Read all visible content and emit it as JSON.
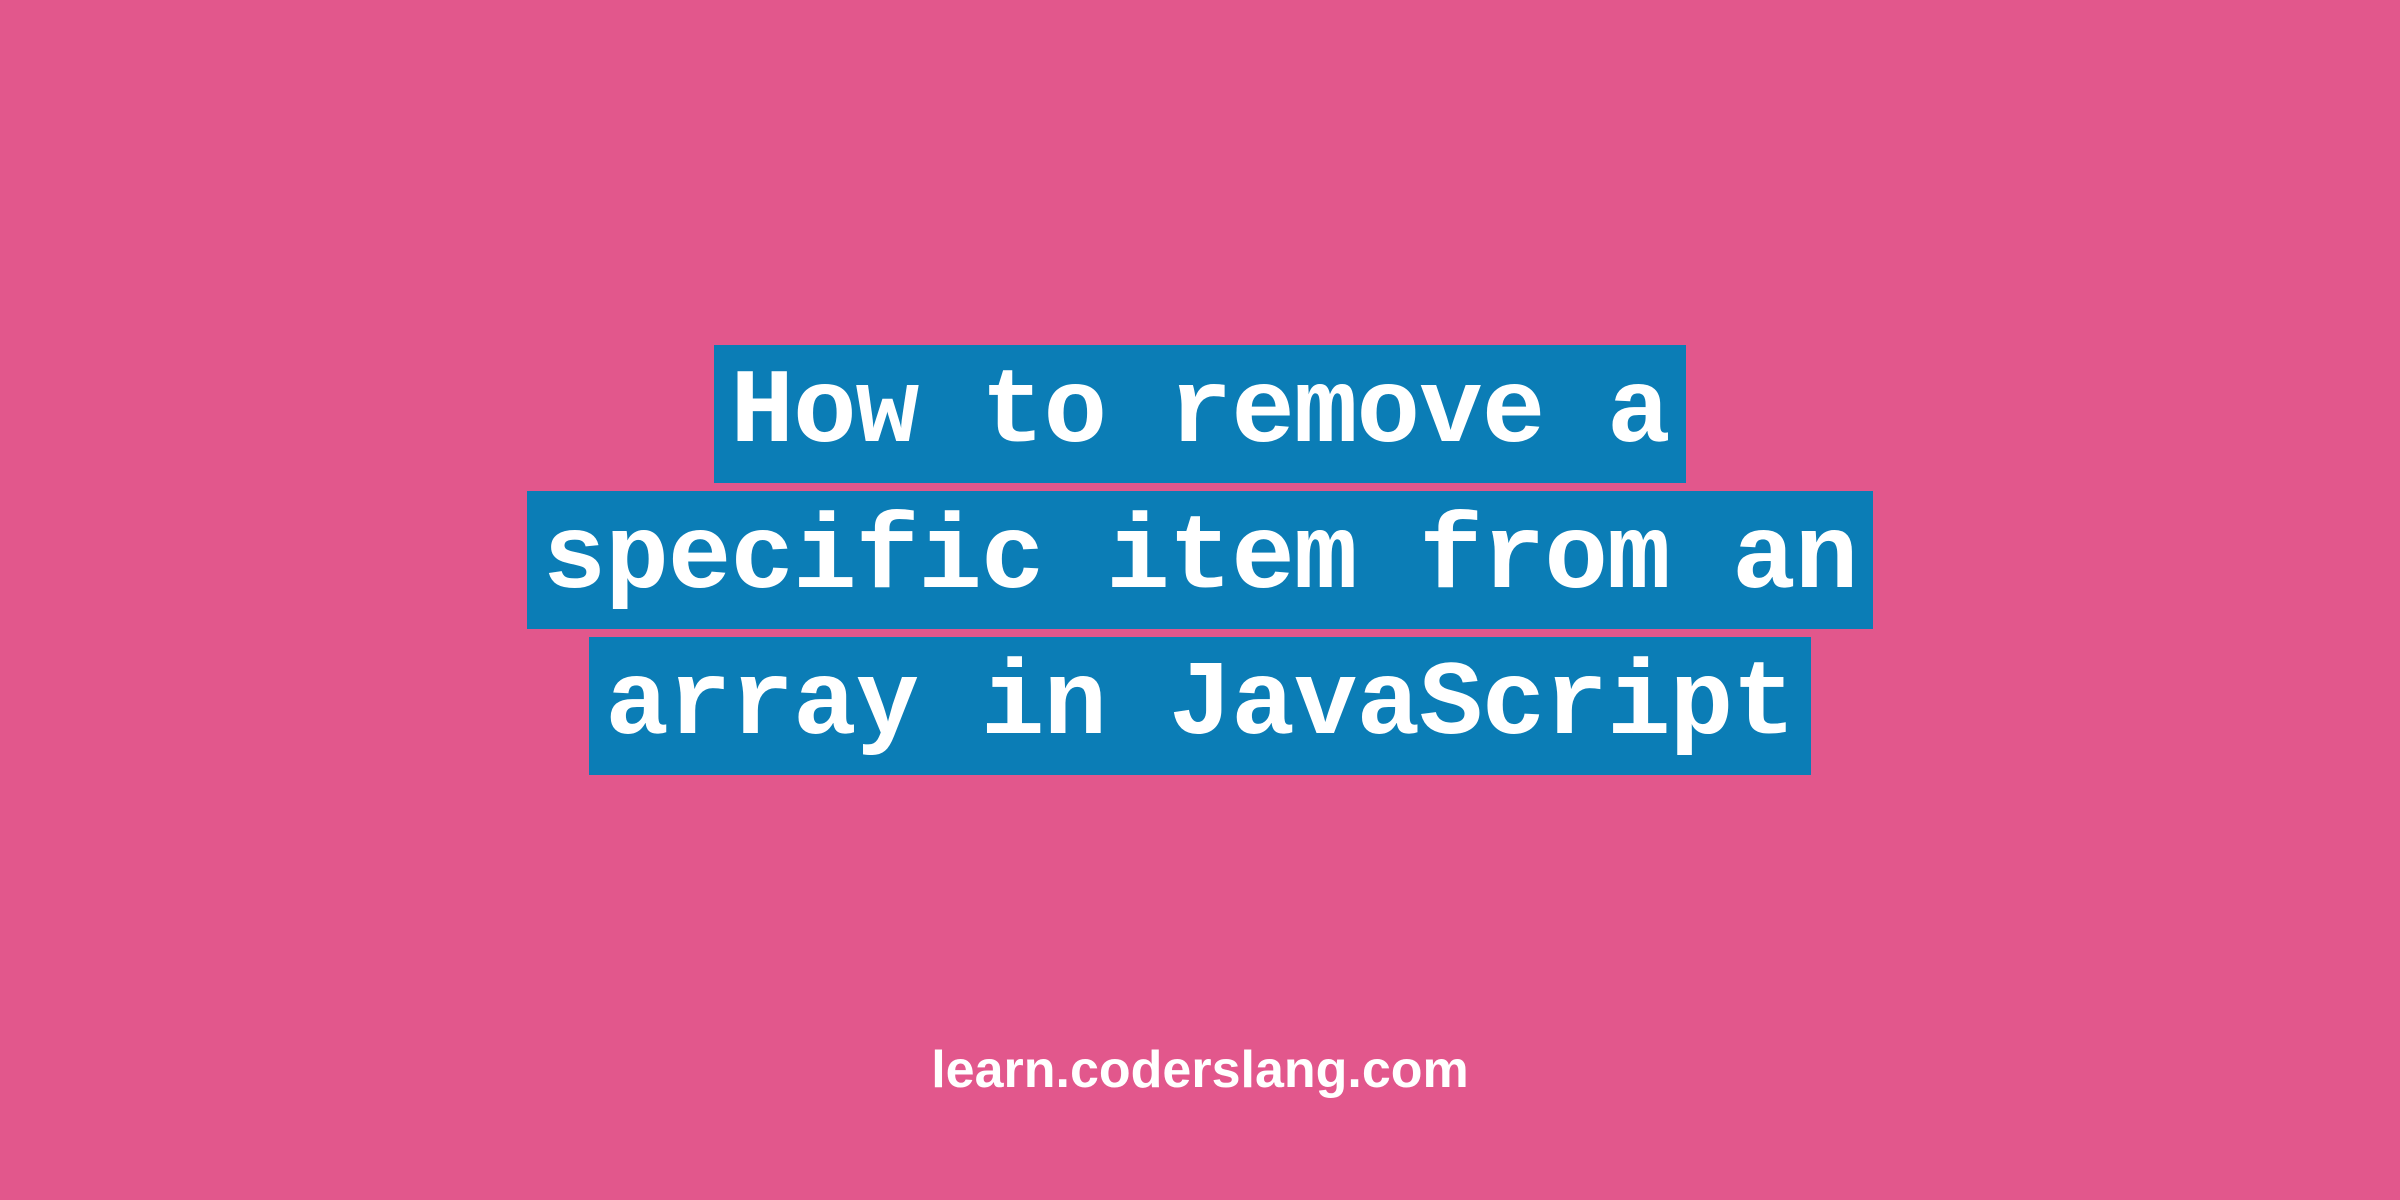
{
  "title": {
    "line1": "How to remove a",
    "line2": "specific item from an",
    "line3": "array in JavaScript"
  },
  "footer": {
    "url": "learn.coderslang.com"
  },
  "colors": {
    "background": "#E2578C",
    "highlight": "#0B7DB6",
    "text": "#FFFFFF"
  }
}
